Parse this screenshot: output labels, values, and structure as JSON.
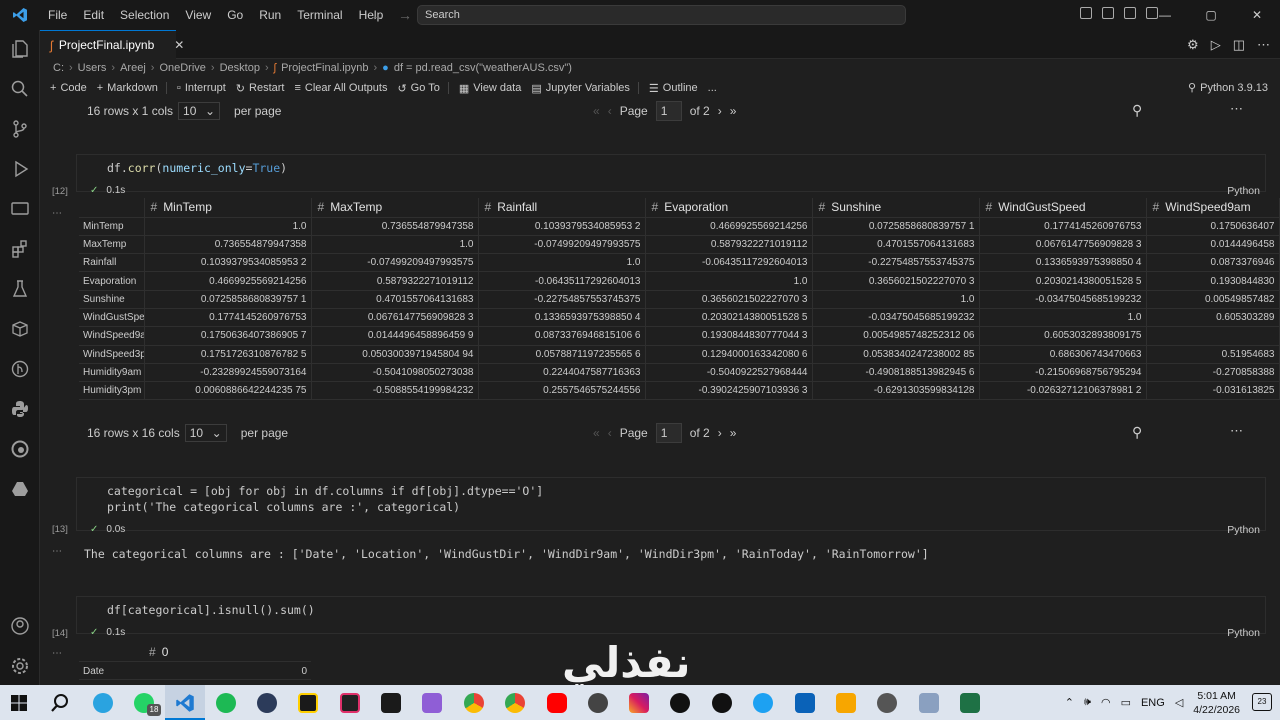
{
  "menu": [
    "File",
    "Edit",
    "Selection",
    "View",
    "Go",
    "Run",
    "Terminal",
    "Help"
  ],
  "search_placeholder": "Search",
  "tab": {
    "title": "ProjectFinal.ipynb"
  },
  "breadcrumb": [
    "C:",
    "Users",
    "Areej",
    "OneDrive",
    "Desktop",
    "ProjectFinal.ipynb",
    "df = pd.read_csv(\"weatherAUS.csv\")"
  ],
  "toolbar": {
    "code": "Code",
    "markdown": "Markdown",
    "interrupt": "Interrupt",
    "restart": "Restart",
    "clear": "Clear All Outputs",
    "goto": "Go To",
    "viewdata": "View data",
    "variables": "Jupyter Variables",
    "outline": "Outline",
    "more": "...",
    "kernel": "Python 3.9.13"
  },
  "pager1": {
    "rows": "16 rows x 1 cols",
    "per_page_value": "10",
    "per_page": "per page",
    "page_label": "Page",
    "page": "1",
    "of": "of 2"
  },
  "cell12": {
    "count": "[12]",
    "code_prefix": "df.",
    "code_fn": "corr",
    "code_arg": "numeric_only",
    "code_eq": "=",
    "code_val": "True",
    "time": "0.1s",
    "lang": "Python"
  },
  "corr_table": {
    "hash": "#",
    "columns": [
      "MinTemp",
      "MaxTemp",
      "Rainfall",
      "Evaporation",
      "Sunshine",
      "WindGustSpeed",
      "WindSpeed9am"
    ],
    "rows": [
      {
        "label": "MinTemp",
        "values": [
          "1.0",
          "0.736554879947358",
          "0.1039379534085953 2",
          "0.4669925569214256",
          "0.0725858680839757 1",
          "0.1774145260976753",
          "0.1750636407"
        ]
      },
      {
        "label": "MaxTemp",
        "values": [
          "0.736554879947358",
          "1.0",
          "-0.07499209497993575",
          "0.5879322271019112",
          "0.4701557064131683",
          "0.0676147756909828 3",
          "0.0144496458"
        ]
      },
      {
        "label": "Rainfall",
        "values": [
          "0.1039379534085953 2",
          "-0.07499209497993575",
          "1.0",
          "-0.06435117292604013",
          "-0.22754857553745375",
          "0.1336593975398850 4",
          "0.0873376946"
        ]
      },
      {
        "label": "Evaporation",
        "values": [
          "0.4669925569214256",
          "0.5879322271019112",
          "-0.06435117292604013",
          "1.0",
          "0.3656021502227070 3",
          "0.2030214380051528 5",
          "0.1930844830"
        ]
      },
      {
        "label": "Sunshine",
        "values": [
          "0.0725858680839757 1",
          "0.4701557064131683",
          "-0.22754857553745375",
          "0.3656021502227070 3",
          "1.0",
          "-0.03475045685199232",
          "0.00549857482"
        ]
      },
      {
        "label": "WindGustSpe",
        "values": [
          "0.1774145260976753",
          "0.0676147756909828 3",
          "0.1336593975398850 4",
          "0.2030214380051528 5",
          "-0.03475045685199232",
          "1.0",
          "0.605303289"
        ]
      },
      {
        "label": "WindSpeed9a",
        "values": [
          "0.1750636407386905 7",
          "0.0144496458896459 9",
          "0.0873376946815106 6",
          "0.1930844830777044 3",
          "0.0054985748252312 06",
          "0.6053032893809175",
          ""
        ]
      },
      {
        "label": "WindSpeed3p",
        "values": [
          "0.1751726310876782 5",
          "0.0503003971945804 94",
          "0.0578871197235565 6",
          "0.1294000163342080 6",
          "0.0538340247238002 85",
          "0.686306743470663",
          "0.51954683"
        ]
      },
      {
        "label": "Humidity9am",
        "values": [
          "-0.23289924559073164",
          "-0.5041098050273038",
          "0.2244047587716363",
          "-0.5040922527968444",
          "-0.4908188513982945 6",
          "-0.21506968756795294",
          "-0.270858388"
        ]
      },
      {
        "label": "Humidity3pm",
        "values": [
          "0.0060886642244235 75",
          "-0.5088554199984232",
          "0.2557546575244556",
          "-0.3902425907103936 3",
          "-0.6291303599834128",
          "-0.02632712106378981 2",
          "-0.031613825"
        ]
      }
    ]
  },
  "pager2": {
    "rows": "16 rows x 16 cols",
    "per_page_value": "10",
    "per_page": "per page",
    "page_label": "Page",
    "page": "1",
    "of": "of 2"
  },
  "cell13": {
    "count": "[13]",
    "line1": "categorical = [obj for obj in df.columns if df[obj].dtype=='O']",
    "line2": "print('The categorical columns are :', categorical)",
    "time": "0.0s",
    "lang": "Python",
    "output": "The categorical columns are : ['Date', 'Location', 'WindGustDir', 'WindDir9am', 'WindDir3pm', 'RainToday', 'RainTomorrow']"
  },
  "cell14": {
    "count": "[14]",
    "code": "df[categorical].isnull().sum()",
    "time": "0.1s",
    "lang": "Python",
    "col_header": "0",
    "hash": "#",
    "row_label": "Date",
    "row_value": "0"
  },
  "watermark": "نفذلي",
  "tray": {
    "lang": "ENG",
    "time": "5:01 AM",
    "date": "4/22/2026",
    "notif": "23"
  },
  "whatsapp_badge": "18",
  "colors": {
    "accent": "#0078d4",
    "check": "#89d185",
    "keyword": "#569cd6",
    "string": "#ce9178"
  }
}
